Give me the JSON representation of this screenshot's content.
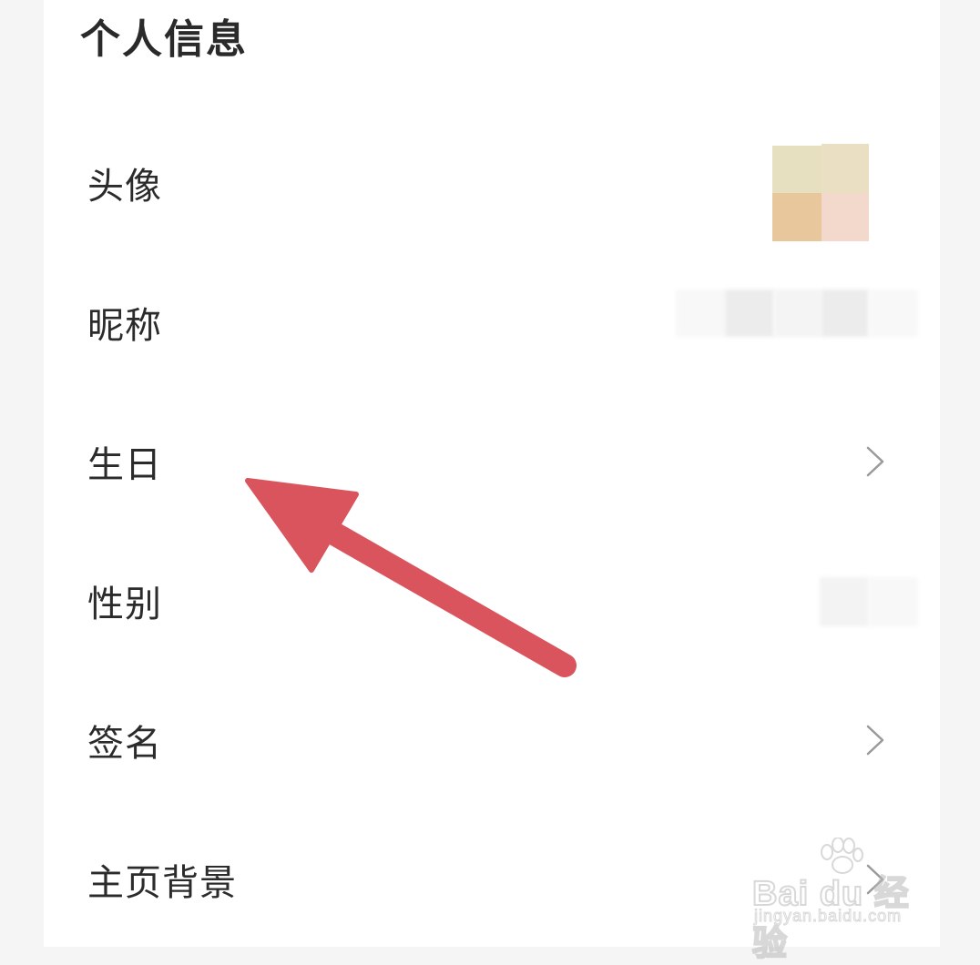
{
  "page": {
    "title": "个人信息"
  },
  "rows": [
    {
      "id": "avatar",
      "label": "头像",
      "has_chevron": false
    },
    {
      "id": "nickname",
      "label": "昵称",
      "has_chevron": false
    },
    {
      "id": "birthday",
      "label": "生日",
      "has_chevron": true
    },
    {
      "id": "gender",
      "label": "性别",
      "has_chevron": false
    },
    {
      "id": "signature",
      "label": "签名",
      "has_chevron": true
    },
    {
      "id": "homepage-background",
      "label": "主页背景",
      "has_chevron": true
    }
  ],
  "annotation": {
    "arrow_color": "#d9545c",
    "points_to": "生日"
  },
  "watermark": {
    "brand": "Bai du 经验",
    "url": "jingyan.baidu.com"
  },
  "colors": {
    "panel": "#ffffff",
    "background": "#f5f5f5",
    "label_text": "#2b2b2b",
    "chevron": "#9a9a9a"
  }
}
